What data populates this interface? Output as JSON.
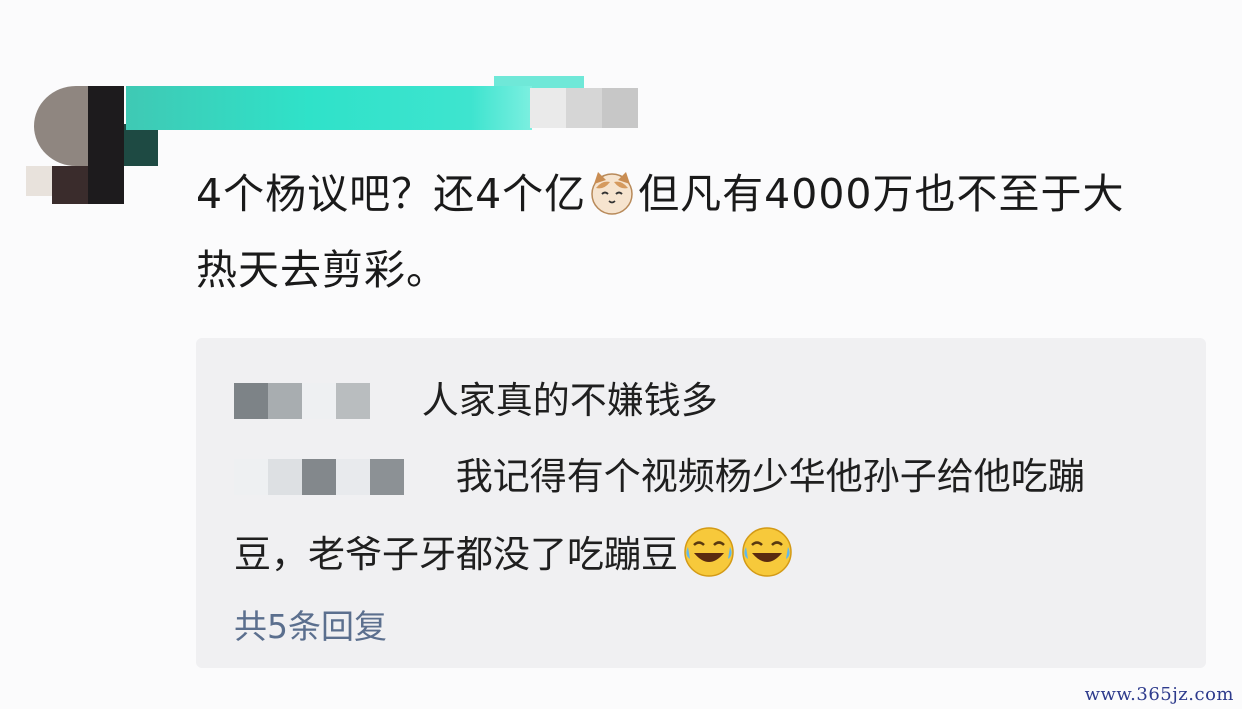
{
  "comment": {
    "line1_a": "4个杨议吧？还4个亿",
    "line1_b": "但凡有4000万也不至于大",
    "line2": "热天去剪彩。",
    "emoji": "cat-face-icon"
  },
  "replies": [
    {
      "text": "人家真的不嫌钱多"
    },
    {
      "text": "我记得有个视频杨少华他孙子给他吃蹦",
      "continuation": "豆，老爷子牙都没了吃蹦豆",
      "emoji": "laughing-crying-icon"
    }
  ],
  "more_replies": "共5条回复",
  "watermark": "www.365jz.com"
}
